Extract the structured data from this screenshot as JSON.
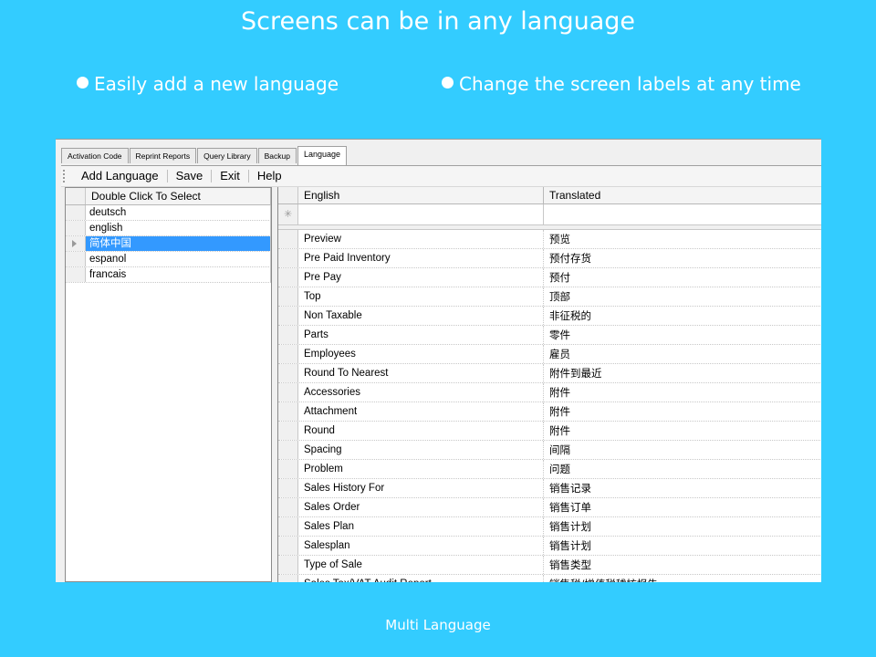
{
  "slide": {
    "title": "Screens can be in any language",
    "bullet_left": "Easily add a new language",
    "bullet_right": "Change the screen labels at any time",
    "footer": "Multi Language"
  },
  "colors": {
    "background": "#33ccff",
    "selection": "#3399ff"
  },
  "tabs": [
    {
      "label": "Activation Code",
      "active": false
    },
    {
      "label": "Reprint Reports",
      "active": false
    },
    {
      "label": "Query Library",
      "active": false
    },
    {
      "label": "Backup",
      "active": false
    },
    {
      "label": "Language",
      "active": true
    }
  ],
  "toolbar": {
    "add_language": "Add Language",
    "save": "Save",
    "exit": "Exit",
    "help": "Help"
  },
  "languages": {
    "header": "Double Click To Select",
    "items": [
      "deutsch",
      "english",
      "简体中国",
      "espanol",
      "francais"
    ],
    "selected_index": 2
  },
  "translations": {
    "col_english": "English",
    "col_translated": "Translated",
    "rows": [
      {
        "en": "Preview",
        "tr": "预览"
      },
      {
        "en": "Pre Paid Inventory",
        "tr": "预付存货"
      },
      {
        "en": "Pre Pay",
        "tr": "预付"
      },
      {
        "en": "Top",
        "tr": "顶部"
      },
      {
        "en": "Non Taxable",
        "tr": "非征税的"
      },
      {
        "en": "Parts",
        "tr": "零件"
      },
      {
        "en": "Employees",
        "tr": "雇员"
      },
      {
        "en": "Round To Nearest",
        "tr": "附件到最近"
      },
      {
        "en": "Accessories",
        "tr": "附件"
      },
      {
        "en": "Attachment",
        "tr": "附件"
      },
      {
        "en": "Round",
        "tr": "附件"
      },
      {
        "en": "Spacing",
        "tr": "间隔"
      },
      {
        "en": "Problem",
        "tr": "问题"
      },
      {
        "en": "Sales History For",
        "tr": "销售记录"
      },
      {
        "en": "Sales Order",
        "tr": "销售订单"
      },
      {
        "en": "Sales Plan",
        "tr": "销售计划"
      },
      {
        "en": "Salesplan",
        "tr": "销售计划"
      },
      {
        "en": "Type of Sale",
        "tr": "销售类型"
      },
      {
        "en": "Sales Tax/VAT Audit Report",
        "tr": "销售税/增值税稽核报告"
      }
    ]
  }
}
